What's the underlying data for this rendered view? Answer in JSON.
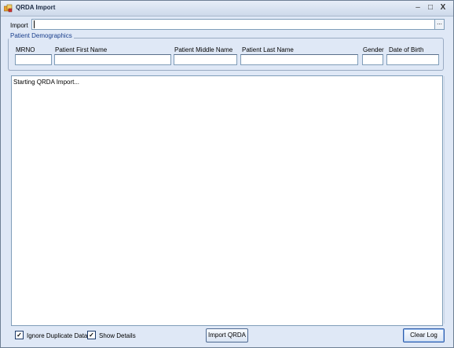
{
  "window": {
    "title": "QRDA Import",
    "controls": {
      "minimize": "‒",
      "maximize": "□",
      "close": "X"
    }
  },
  "import": {
    "label": "Import",
    "path_value": "",
    "browse_label": "..."
  },
  "demographics": {
    "group_label": "Patient Demographics",
    "fields": [
      {
        "label": "MRNO",
        "value": ""
      },
      {
        "label": "Patient First Name",
        "value": ""
      },
      {
        "label": "Patient Middle Name",
        "value": ""
      },
      {
        "label": "Patient Last Name",
        "value": ""
      },
      {
        "label": "Gender",
        "value": ""
      },
      {
        "label": "Date of Birth",
        "value": ""
      }
    ]
  },
  "log": {
    "text": "Starting QRDA Import..."
  },
  "options": {
    "ignore_duplicate": {
      "label": "Ignore Duplicate Data",
      "checked": true,
      "mark": "✓"
    },
    "show_details": {
      "label": "Show Details",
      "checked": true,
      "mark": "✓"
    }
  },
  "buttons": {
    "import": "Import QRDA",
    "clear_log": "Clear Log"
  },
  "colors": {
    "window_bg": "#dfe8f6",
    "group_label": "#1a3f8c",
    "border": "#7f9db9"
  }
}
